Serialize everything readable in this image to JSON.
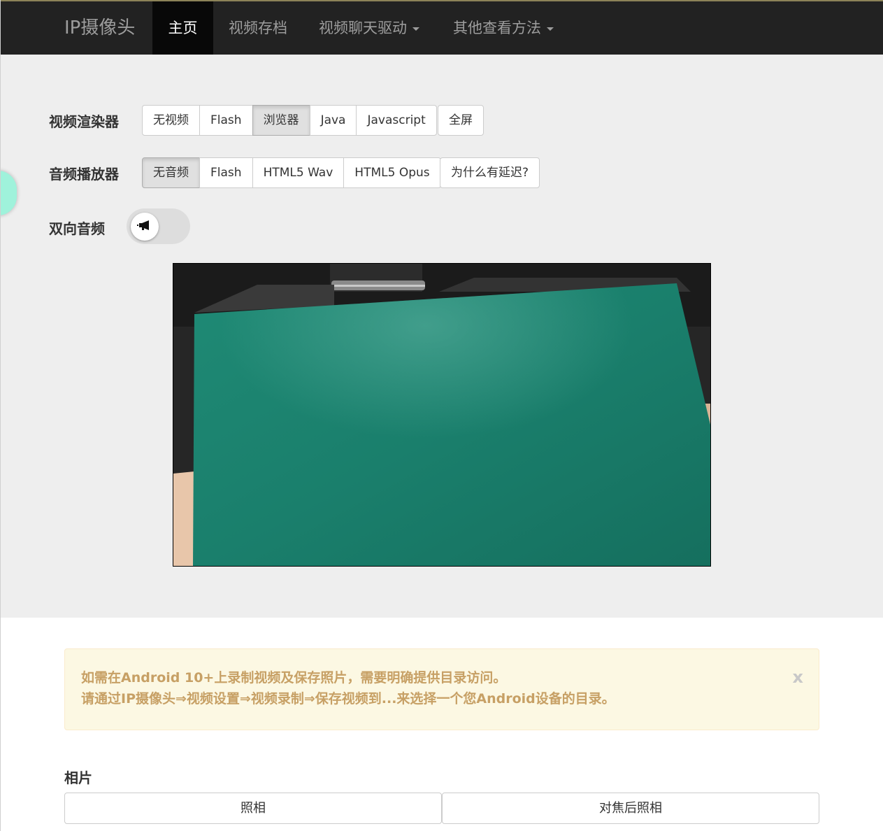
{
  "nav": {
    "brand": "IP摄像头",
    "items": [
      {
        "label": "主页",
        "active": true
      },
      {
        "label": "视频存档"
      },
      {
        "label": "视频聊天驱动",
        "dropdown": true
      },
      {
        "label": "其他查看方法",
        "dropdown": true
      }
    ]
  },
  "video_renderer": {
    "label": "视频渲染器",
    "options": [
      "无视频",
      "Flash",
      "浏览器",
      "Java",
      "Javascript"
    ],
    "selected": "浏览器",
    "fullscreen": "全屏"
  },
  "audio_player": {
    "label": "音频播放器",
    "options": [
      "无音频",
      "Flash",
      "HTML5 Wav",
      "HTML5 Opus"
    ],
    "selected": "无音频",
    "why_delay": "为什么有延迟?"
  },
  "two_way_audio": {
    "label": "双向音频",
    "icon": "megaphone-icon",
    "enabled": false
  },
  "alert": {
    "line1": "如需在Android 10+上录制视频及保存照片，需要明确提供目录访问。",
    "line2": "请通过IP摄像头⇒视频设置⇒视频录制⇒保存视频到...来选择一个您Android设备的目录。",
    "close": "x"
  },
  "photo": {
    "title": "相片",
    "take_photo": "照相",
    "focus_photo": "对焦后照相"
  },
  "colors": {
    "navbar_bg": "#222222",
    "alert_text": "#c7a065",
    "alert_bg": "#fcf8e3",
    "jumbotron_bg": "#eeeeee"
  }
}
